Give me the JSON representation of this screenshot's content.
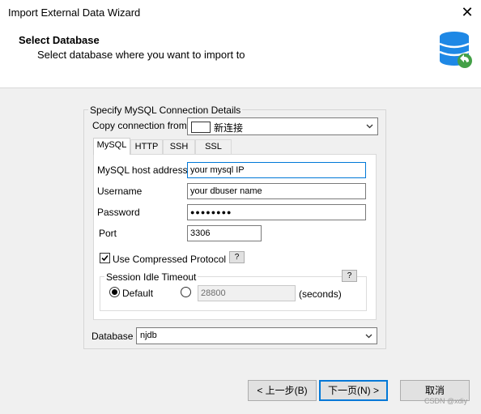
{
  "window": {
    "title": "Import External Data Wizard"
  },
  "header": {
    "title": "Select Database",
    "subtitle": "Select database where you want to import to"
  },
  "group": {
    "legend": "Specify MySQL Connection Details",
    "copy_label": "Copy connection from",
    "copy_value": "新连接"
  },
  "tabs": [
    "MySQL",
    "HTTP",
    "SSH",
    "SSL"
  ],
  "form": {
    "host_label": "MySQL host address",
    "host_value": "your mysql IP",
    "username_label": "Username",
    "username_value": "your dbuser name",
    "password_label": "Password",
    "password_value": "●●●●●●●●",
    "port_label": "Port",
    "port_value": "3306",
    "compressed_label": "Use Compressed Protocol",
    "compressed_checked": true,
    "help": "?"
  },
  "session": {
    "legend": "Session Idle Timeout",
    "default_label": "Default",
    "timeout_value": "28800",
    "unit": "(seconds)"
  },
  "database": {
    "label": "Database",
    "value": "njdb"
  },
  "buttons": {
    "back": "< 上一步(B)",
    "next": "下一页(N) >",
    "cancel": "取消"
  },
  "watermark": "CSDN @xdiy"
}
